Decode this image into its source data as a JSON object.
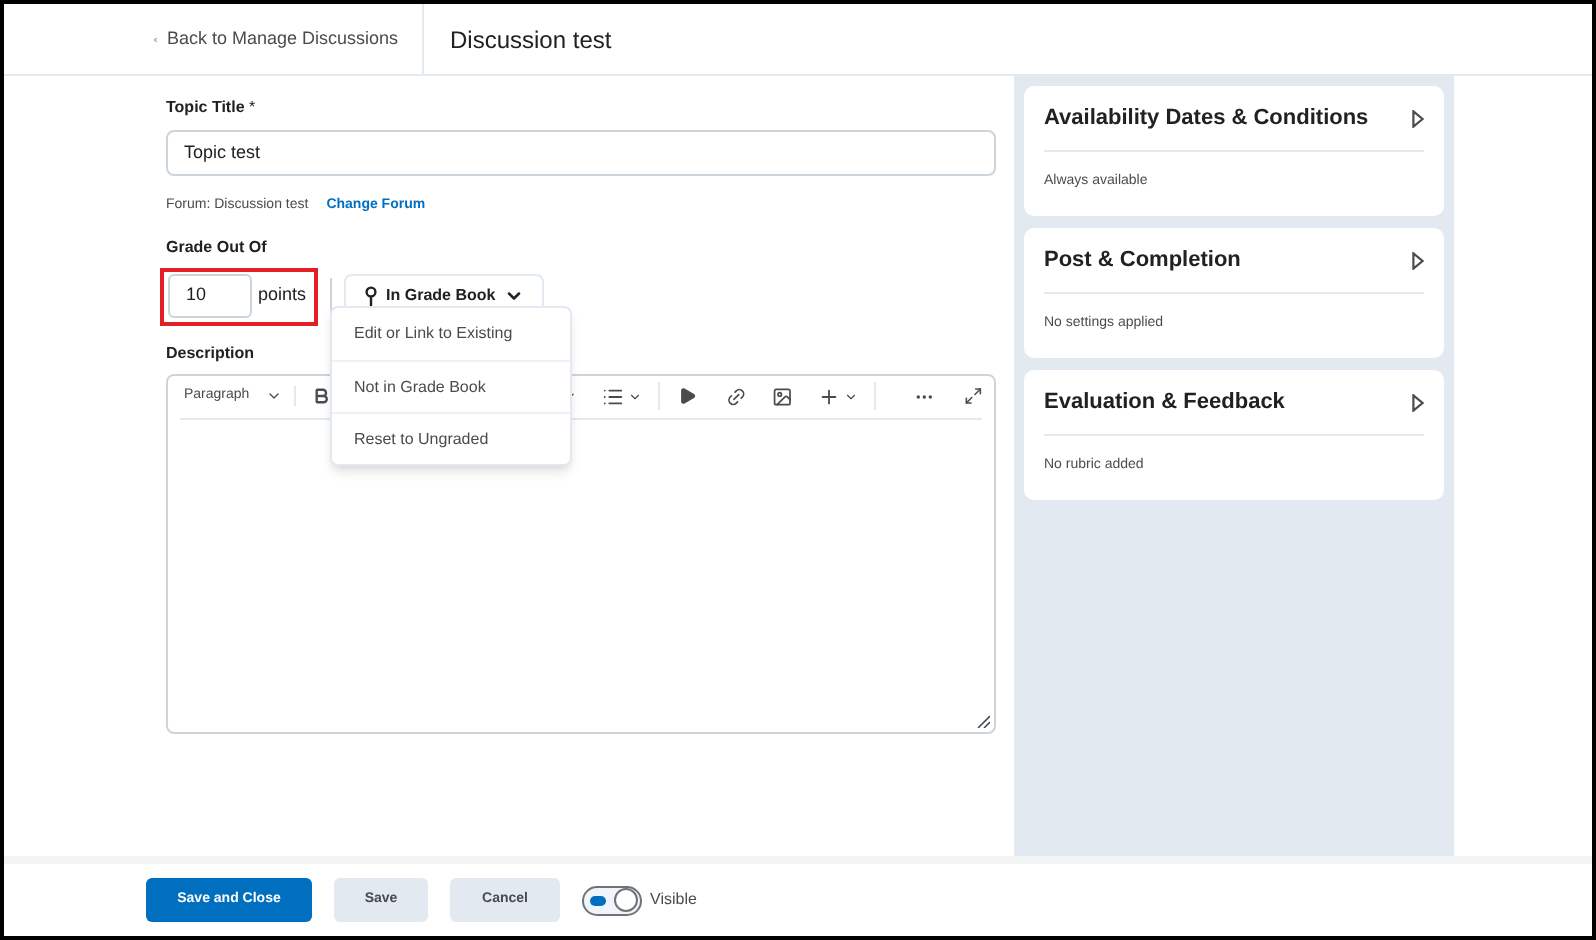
{
  "header": {
    "back_link": "Back to Manage Discussions",
    "title": "Discussion test"
  },
  "topic_title": {
    "label": "Topic Title",
    "required_mark": "*",
    "value": "Topic test"
  },
  "forum": {
    "text": "Forum: Discussion test",
    "change_link": "Change Forum"
  },
  "grade": {
    "label": "Grade Out Of",
    "value": "10",
    "unit": "points",
    "highlighted": true,
    "grade_book_button": "In Grade Book",
    "menu_open": true
  },
  "grade_menu": [
    {
      "label": "Edit or Link to Existing"
    },
    {
      "label": "Not in Grade Book"
    },
    {
      "label": "Reset to Ungraded"
    }
  ],
  "description": {
    "label": "Description",
    "format": "Paragraph"
  },
  "side_panels": [
    {
      "title": "Availability Dates & Conditions",
      "summary": "Always available"
    },
    {
      "title": "Post & Completion",
      "summary": "No settings applied"
    },
    {
      "title": "Evaluation & Feedback",
      "summary": "No rubric added"
    }
  ],
  "footer": {
    "buttons": [
      {
        "label": "Save and Close",
        "kind": "primary"
      },
      {
        "label": "Save",
        "kind": "secondary"
      },
      {
        "label": "Cancel",
        "kind": "secondary"
      }
    ],
    "visibility": {
      "label": "Visible",
      "on": true
    }
  }
}
